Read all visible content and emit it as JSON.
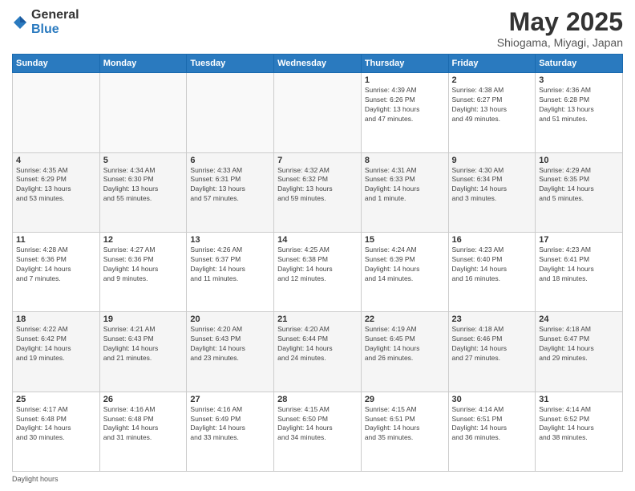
{
  "logo": {
    "general": "General",
    "blue": "Blue"
  },
  "title": "May 2025",
  "subtitle": "Shiogama, Miyagi, Japan",
  "weekdays": [
    "Sunday",
    "Monday",
    "Tuesday",
    "Wednesday",
    "Thursday",
    "Friday",
    "Saturday"
  ],
  "weeks": [
    [
      {
        "day": "",
        "info": ""
      },
      {
        "day": "",
        "info": ""
      },
      {
        "day": "",
        "info": ""
      },
      {
        "day": "",
        "info": ""
      },
      {
        "day": "1",
        "info": "Sunrise: 4:39 AM\nSunset: 6:26 PM\nDaylight: 13 hours\nand 47 minutes."
      },
      {
        "day": "2",
        "info": "Sunrise: 4:38 AM\nSunset: 6:27 PM\nDaylight: 13 hours\nand 49 minutes."
      },
      {
        "day": "3",
        "info": "Sunrise: 4:36 AM\nSunset: 6:28 PM\nDaylight: 13 hours\nand 51 minutes."
      }
    ],
    [
      {
        "day": "4",
        "info": "Sunrise: 4:35 AM\nSunset: 6:29 PM\nDaylight: 13 hours\nand 53 minutes."
      },
      {
        "day": "5",
        "info": "Sunrise: 4:34 AM\nSunset: 6:30 PM\nDaylight: 13 hours\nand 55 minutes."
      },
      {
        "day": "6",
        "info": "Sunrise: 4:33 AM\nSunset: 6:31 PM\nDaylight: 13 hours\nand 57 minutes."
      },
      {
        "day": "7",
        "info": "Sunrise: 4:32 AM\nSunset: 6:32 PM\nDaylight: 13 hours\nand 59 minutes."
      },
      {
        "day": "8",
        "info": "Sunrise: 4:31 AM\nSunset: 6:33 PM\nDaylight: 14 hours\nand 1 minute."
      },
      {
        "day": "9",
        "info": "Sunrise: 4:30 AM\nSunset: 6:34 PM\nDaylight: 14 hours\nand 3 minutes."
      },
      {
        "day": "10",
        "info": "Sunrise: 4:29 AM\nSunset: 6:35 PM\nDaylight: 14 hours\nand 5 minutes."
      }
    ],
    [
      {
        "day": "11",
        "info": "Sunrise: 4:28 AM\nSunset: 6:36 PM\nDaylight: 14 hours\nand 7 minutes."
      },
      {
        "day": "12",
        "info": "Sunrise: 4:27 AM\nSunset: 6:36 PM\nDaylight: 14 hours\nand 9 minutes."
      },
      {
        "day": "13",
        "info": "Sunrise: 4:26 AM\nSunset: 6:37 PM\nDaylight: 14 hours\nand 11 minutes."
      },
      {
        "day": "14",
        "info": "Sunrise: 4:25 AM\nSunset: 6:38 PM\nDaylight: 14 hours\nand 12 minutes."
      },
      {
        "day": "15",
        "info": "Sunrise: 4:24 AM\nSunset: 6:39 PM\nDaylight: 14 hours\nand 14 minutes."
      },
      {
        "day": "16",
        "info": "Sunrise: 4:23 AM\nSunset: 6:40 PM\nDaylight: 14 hours\nand 16 minutes."
      },
      {
        "day": "17",
        "info": "Sunrise: 4:23 AM\nSunset: 6:41 PM\nDaylight: 14 hours\nand 18 minutes."
      }
    ],
    [
      {
        "day": "18",
        "info": "Sunrise: 4:22 AM\nSunset: 6:42 PM\nDaylight: 14 hours\nand 19 minutes."
      },
      {
        "day": "19",
        "info": "Sunrise: 4:21 AM\nSunset: 6:43 PM\nDaylight: 14 hours\nand 21 minutes."
      },
      {
        "day": "20",
        "info": "Sunrise: 4:20 AM\nSunset: 6:43 PM\nDaylight: 14 hours\nand 23 minutes."
      },
      {
        "day": "21",
        "info": "Sunrise: 4:20 AM\nSunset: 6:44 PM\nDaylight: 14 hours\nand 24 minutes."
      },
      {
        "day": "22",
        "info": "Sunrise: 4:19 AM\nSunset: 6:45 PM\nDaylight: 14 hours\nand 26 minutes."
      },
      {
        "day": "23",
        "info": "Sunrise: 4:18 AM\nSunset: 6:46 PM\nDaylight: 14 hours\nand 27 minutes."
      },
      {
        "day": "24",
        "info": "Sunrise: 4:18 AM\nSunset: 6:47 PM\nDaylight: 14 hours\nand 29 minutes."
      }
    ],
    [
      {
        "day": "25",
        "info": "Sunrise: 4:17 AM\nSunset: 6:48 PM\nDaylight: 14 hours\nand 30 minutes."
      },
      {
        "day": "26",
        "info": "Sunrise: 4:16 AM\nSunset: 6:48 PM\nDaylight: 14 hours\nand 31 minutes."
      },
      {
        "day": "27",
        "info": "Sunrise: 4:16 AM\nSunset: 6:49 PM\nDaylight: 14 hours\nand 33 minutes."
      },
      {
        "day": "28",
        "info": "Sunrise: 4:15 AM\nSunset: 6:50 PM\nDaylight: 14 hours\nand 34 minutes."
      },
      {
        "day": "29",
        "info": "Sunrise: 4:15 AM\nSunset: 6:51 PM\nDaylight: 14 hours\nand 35 minutes."
      },
      {
        "day": "30",
        "info": "Sunrise: 4:14 AM\nSunset: 6:51 PM\nDaylight: 14 hours\nand 36 minutes."
      },
      {
        "day": "31",
        "info": "Sunrise: 4:14 AM\nSunset: 6:52 PM\nDaylight: 14 hours\nand 38 minutes."
      }
    ]
  ],
  "footer": {
    "daylight_hours": "Daylight hours"
  }
}
